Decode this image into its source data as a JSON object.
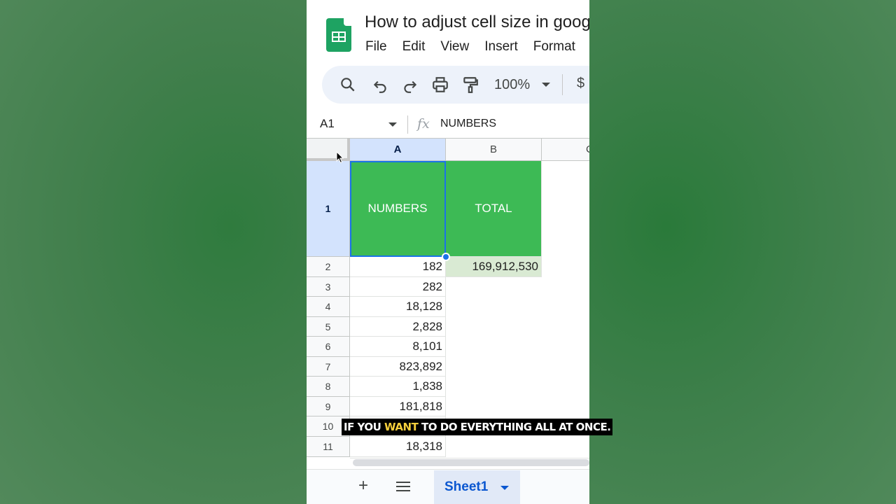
{
  "document": {
    "title": "How to adjust cell size in goog",
    "menu": [
      "File",
      "Edit",
      "View",
      "Insert",
      "Format"
    ]
  },
  "toolbar": {
    "icons": [
      "search-icon",
      "undo-icon",
      "redo-icon",
      "print-icon",
      "paint-format-icon"
    ],
    "zoom": "100%",
    "currency": "$"
  },
  "formula_bar": {
    "name_box": "A1",
    "fx_label": "fx",
    "value": "NUMBERS"
  },
  "grid": {
    "columns": [
      "A",
      "B",
      "C"
    ],
    "rows": [
      "1",
      "2",
      "3",
      "4",
      "5",
      "6",
      "7",
      "8",
      "9",
      "10",
      "11"
    ],
    "header_row": [
      "NUMBERS",
      "TOTAL"
    ],
    "column_a": [
      "182",
      "282",
      "18,128",
      "2,828",
      "8,101",
      "823,892",
      "1,838",
      "181,818",
      "",
      "18,318"
    ],
    "total_value": "169,912,530",
    "colors": {
      "header_fill": "#3dba55",
      "total_fill": "#d9ead3",
      "selection": "#1a73e8"
    }
  },
  "sheet_tabs": {
    "active": "Sheet1"
  },
  "caption": {
    "before": "IF YOU ",
    "highlight": "WANT",
    "after": " TO DO EVERYTHING ALL AT ONCE."
  }
}
